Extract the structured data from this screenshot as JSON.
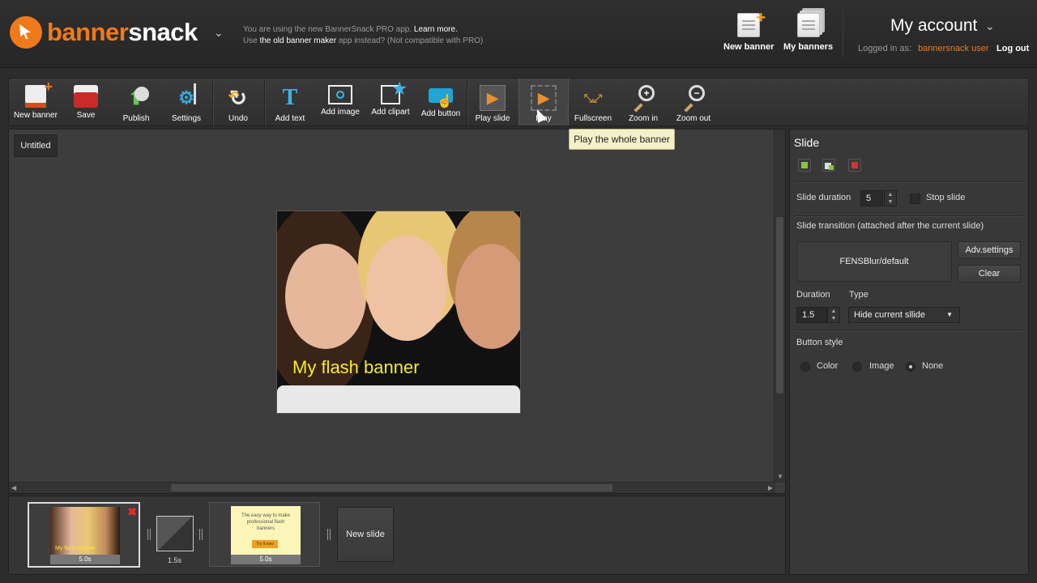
{
  "header": {
    "logo_part1": "banner",
    "logo_part2": "snack",
    "notice_line1_prefix": "You are using the new BannerSnack PRO app. ",
    "notice_learn_more": "Learn more.",
    "notice_line2_prefix": "Use ",
    "notice_old_maker": "the old banner maker",
    "notice_line2_suffix": " app instead? (Not compatible with PRO)",
    "new_banner_label": "New banner",
    "my_banners_label": "My banners",
    "my_account_label": "My account",
    "logged_in_label": "Logged in as:",
    "username": "bannersnack user",
    "logout_label": "Log out"
  },
  "toolbar": {
    "new_banner": "New banner",
    "save": "Save",
    "publish": "Publish",
    "settings": "Settings",
    "undo": "Undo",
    "add_text": "Add text",
    "add_image": "Add image",
    "add_clipart": "Add clipart",
    "add_button": "Add button",
    "play_slide": "Play slide",
    "play": "Play",
    "fullscreen": "Fullscreen",
    "zoom_in": "Zoom in",
    "zoom_out": "Zoom out"
  },
  "tooltip": "Play the whole banner",
  "canvas": {
    "doc_tab": "Untitled",
    "banner_text": "My flash banner"
  },
  "panel": {
    "title": "Slide",
    "slide_duration_label": "Slide duration",
    "slide_duration_value": "5",
    "stop_slide_label": "Stop slide",
    "transition_label": "Slide transition (attached after the current slide)",
    "transition_value": "FENSBlur/default",
    "adv_settings": "Adv.settings",
    "clear": "Clear",
    "duration_label": "Duration",
    "type_label": "Type",
    "duration_value": "1.5",
    "type_value": "Hide current sllide",
    "button_style_label": "Button style",
    "style_options": [
      "Color",
      "Image",
      "None"
    ],
    "selected_style": "None"
  },
  "filmstrip": {
    "slide1_duration": "5.0s",
    "slide1_caption": "My flash banner",
    "transition_duration": "1.5s",
    "slide2_text": "The easy way to make professional flash banners",
    "slide2_button": "Try it now",
    "slide2_duration": "5.0s",
    "new_slide": "New slide"
  },
  "colors": {
    "brand_orange": "#f07a1a",
    "banner_text": "#f5eb2a",
    "tooltip_bg": "#f4f1c8"
  }
}
